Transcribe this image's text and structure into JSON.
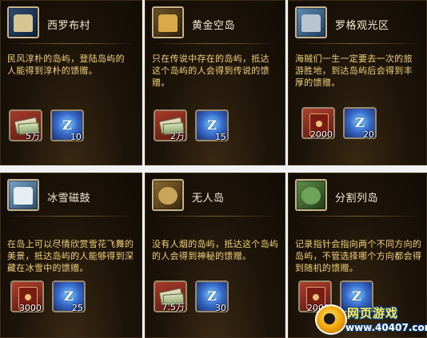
{
  "islands": [
    {
      "name": "西罗布村",
      "icon": "village-icon",
      "description": "民风淳朴的岛屿，登陆岛屿的人能得到淳朴的馈赠。",
      "rewards": [
        {
          "icon": "money-icon",
          "quantity": "5万"
        },
        {
          "icon": "crystal-gem-icon",
          "quantity": "10"
        }
      ]
    },
    {
      "name": "黄金空岛",
      "icon": "golden-temple-icon",
      "description": "只在传说中存在的岛屿，抵达这个岛屿的人会得到传说的馈赠。",
      "rewards": [
        {
          "icon": "money-icon",
          "quantity": "2万"
        },
        {
          "icon": "crystal-gem-icon",
          "quantity": "15"
        }
      ]
    },
    {
      "name": "罗格观光区",
      "icon": "sightseeing-town-icon",
      "description": "海贼们一生一定要去一次的旅游胜地，到达岛屿后会得到丰厚的馈赠。",
      "rewards": [
        {
          "icon": "red-book-icon",
          "quantity": "2000"
        },
        {
          "icon": "crystal-gem-icon",
          "quantity": "20"
        }
      ]
    },
    {
      "name": "冰雪磁鼓",
      "icon": "snow-castle-icon",
      "description": "在岛上可以尽情欣赏雪花飞舞的美景，抵达岛屿的人能够得到深藏在冰雪中的馈赠。",
      "rewards": [
        {
          "icon": "red-book-icon",
          "quantity": "3000"
        },
        {
          "icon": "crystal-gem-icon",
          "quantity": "25"
        }
      ]
    },
    {
      "name": "无人岛",
      "icon": "rock-island-icon",
      "description": "没有人烟的岛屿，抵达这个岛屿的人会得到神秘的馈赠。",
      "rewards": [
        {
          "icon": "money-icon",
          "quantity": "7.5万"
        },
        {
          "icon": "crystal-gem-icon",
          "quantity": "30"
        }
      ]
    },
    {
      "name": "分割列岛",
      "icon": "split-islands-icon",
      "description": "记录指针会指向两个不同方向的岛屿，不管选择哪个方向都会得到随机的馈赠。",
      "rewards": [
        {
          "icon": "red-book-icon",
          "quantity": "2000"
        },
        {
          "icon": "crystal-gem-icon",
          "quantity": ""
        }
      ]
    }
  ],
  "watermark": {
    "title": "网页游戏",
    "url": "www.40407.com"
  }
}
